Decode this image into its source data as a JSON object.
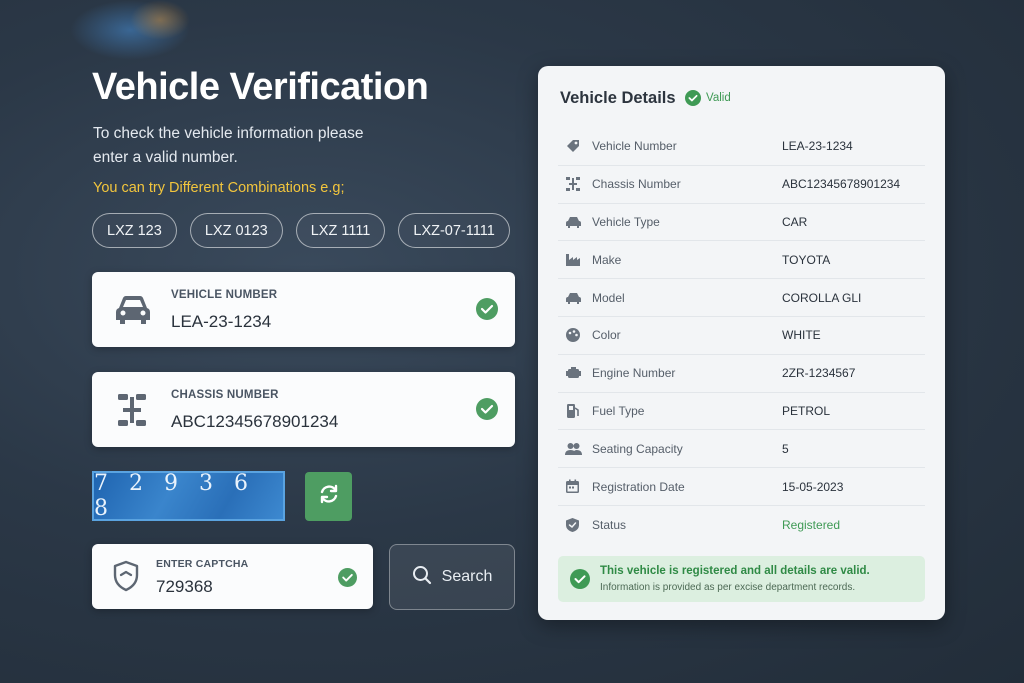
{
  "heading": {
    "title": "Vehicle Verification",
    "description": "To check the vehicle information please enter a valid number.",
    "hint": "You can try Different Combinations e.g;"
  },
  "examples": [
    "LXZ 123",
    "LXZ 0123",
    "LXZ 1111",
    "LXZ-07-1111"
  ],
  "vehicle_field": {
    "label": "VEHICLE NUMBER",
    "value": "LEA-23-1234"
  },
  "chassis_field": {
    "label": "CHASSIS NUMBER",
    "value": "ABC12345678901234"
  },
  "captcha": {
    "image_text": "729368"
  },
  "captcha_field": {
    "label": "ENTER CAPTCHA",
    "value": "729368"
  },
  "search_button": {
    "label": "Search"
  },
  "details": {
    "title": "Vehicle Details",
    "badge": "Valid",
    "rows": [
      {
        "icon": "tag-icon",
        "label": "Vehicle Number",
        "value": "LEA-23-1234"
      },
      {
        "icon": "chassis-icon",
        "label": "Chassis Number",
        "value": "ABC12345678901234"
      },
      {
        "icon": "car-icon",
        "label": "Vehicle Type",
        "value": "CAR"
      },
      {
        "icon": "factory-icon",
        "label": "Make",
        "value": "TOYOTA"
      },
      {
        "icon": "car-icon",
        "label": "Model",
        "value": "COROLLA GLI"
      },
      {
        "icon": "palette-icon",
        "label": "Color",
        "value": "WHITE"
      },
      {
        "icon": "engine-icon",
        "label": "Engine Number",
        "value": "2ZR-1234567"
      },
      {
        "icon": "fuel-icon",
        "label": "Fuel Type",
        "value": "PETROL"
      },
      {
        "icon": "users-icon",
        "label": "Seating Capacity",
        "value": "5"
      },
      {
        "icon": "calendar-icon",
        "label": "Registration Date",
        "value": "15-05-2023"
      },
      {
        "icon": "shield-icon",
        "label": "Status",
        "value": "Registered"
      }
    ],
    "notice": {
      "main": "This vehicle is registered and all details are valid.",
      "sub": "Information is provided as per excise department records."
    }
  },
  "colors": {
    "accent_green": "#4e9d62",
    "hint_yellow": "#f2c53d",
    "status_green": "#3f9a55"
  }
}
